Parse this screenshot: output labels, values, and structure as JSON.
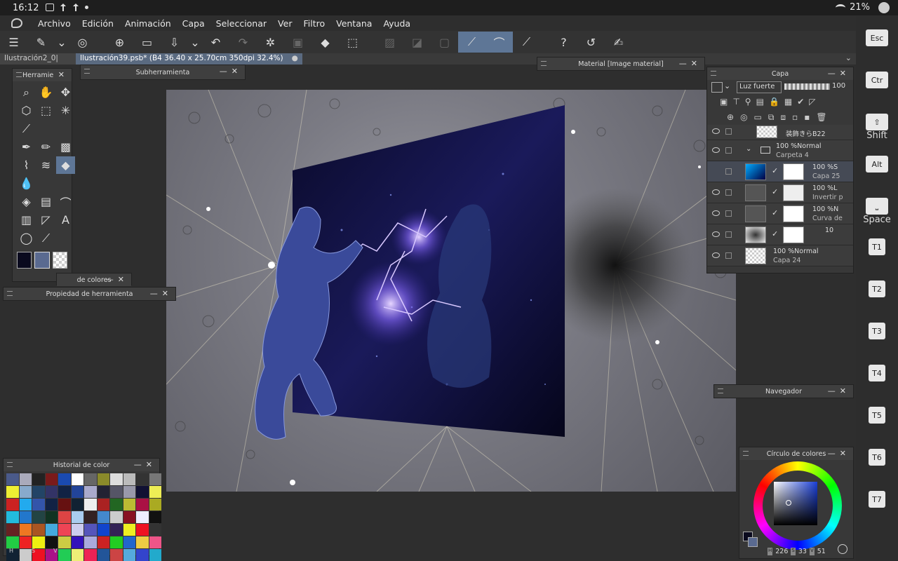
{
  "status": {
    "time": "16:12",
    "battery": "21%"
  },
  "menu": [
    "Archivo",
    "Edición",
    "Animación",
    "Capa",
    "Seleccionar",
    "Ver",
    "Filtro",
    "Ventana",
    "Ayuda"
  ],
  "tabs": [
    {
      "label": "Ilustración2_0|"
    },
    {
      "label": "Ilustración39.psb* (B4 36.40 x 25.70cm 350dpi 32.4%)"
    }
  ],
  "panels": {
    "tools": {
      "title": "Herramie"
    },
    "subtool": {
      "title": "Subherramienta"
    },
    "material": {
      "title": "Material [Image material]"
    },
    "layer": {
      "title": "Capa",
      "blend": "Luz fuerte",
      "opacity": "100"
    },
    "color_set": {
      "title": "de colores"
    },
    "tool_property": {
      "title": "Propiedad de herramienta"
    },
    "navigator": {
      "title": "Navegador"
    },
    "color_history": {
      "title": "Historial de color",
      "footer": [
        "H",
        "S",
        "V"
      ]
    },
    "color_wheel": {
      "title": "Círculo de colores",
      "h_label": "H",
      "h": "226",
      "s_label": "S",
      "s": "33",
      "v_label": "V",
      "v": "51"
    }
  },
  "layers": [
    {
      "line1": "装飾きらB22",
      "line2": ""
    },
    {
      "line1": "100 %Normal",
      "line2": "Carpeta 4"
    },
    {
      "line1": "100 %S",
      "line2": "Capa 25"
    },
    {
      "line1": "100 %L",
      "line2": "Invertir p"
    },
    {
      "line1": "100 %N",
      "line2": "Curva de"
    },
    {
      "line1": "10",
      "line2": ""
    },
    {
      "line1": "100 %Normal",
      "line2": "Capa 24"
    }
  ],
  "shortcuts": {
    "esc": "Esc",
    "ctrl": "Ctr",
    "shift": "Shift",
    "alt": "Alt",
    "space": "Space",
    "t": [
      "T1",
      "T2",
      "T3",
      "T4",
      "T5",
      "T6",
      "T7"
    ]
  },
  "colors": {
    "accent": "#5e7696",
    "main_color": "#0a0a1e",
    "sub_color": "#5a6a90"
  }
}
